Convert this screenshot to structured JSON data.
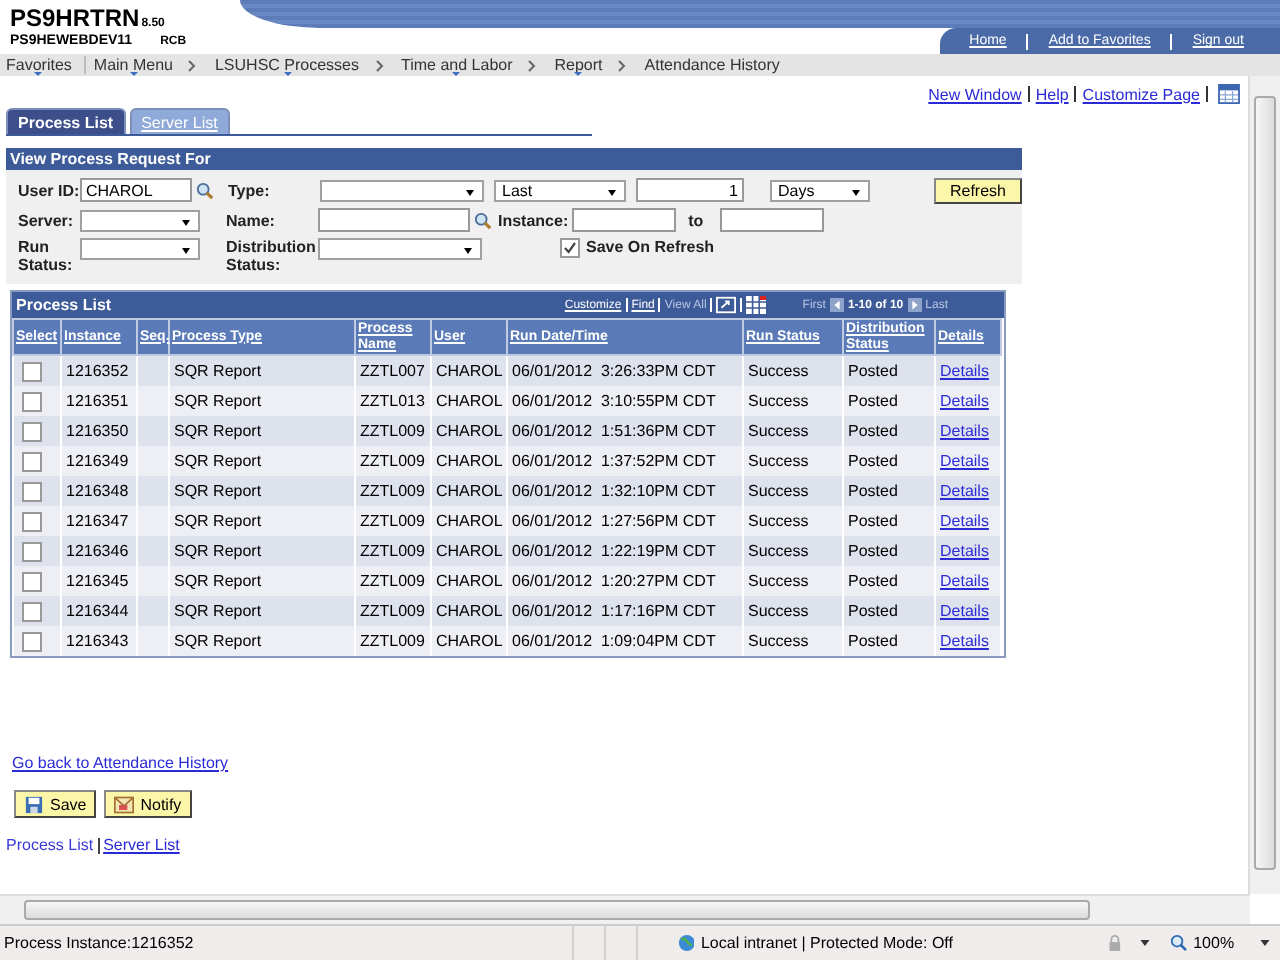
{
  "header": {
    "system": "PS9HRTRN",
    "version": "8.50",
    "server": "PS9HEWEBDEV11",
    "user_code": "RCB",
    "links": [
      "Home",
      "Add to Favorites",
      "Sign out"
    ]
  },
  "nav": [
    {
      "label": "Favorites",
      "menu": true
    },
    {
      "label": "Main Menu",
      "menu": true
    },
    {
      "label": "LSUHSC Processes",
      "menu": true
    },
    {
      "label": "Time and Labor",
      "menu": true
    },
    {
      "label": "Report",
      "menu": true
    },
    {
      "label": "Attendance History",
      "menu": false
    }
  ],
  "page_links": [
    "New Window",
    "Help",
    "Customize Page"
  ],
  "tabs": [
    {
      "label": "Process List",
      "selected": true
    },
    {
      "label": "Server List",
      "selected": false
    }
  ],
  "filter": {
    "title": "View Process Request For",
    "user_id": {
      "label": "User ID:",
      "value": "CHAROL"
    },
    "type": {
      "label": "Type:"
    },
    "range": {
      "mode": "Last",
      "count": "1",
      "period": "Days"
    },
    "refresh": "Refresh",
    "server": {
      "label": "Server:"
    },
    "name": {
      "label": "Name:"
    },
    "instance": {
      "label": "Instance:",
      "to": "to"
    },
    "run_status": {
      "label": "Run Status:"
    },
    "distribution_status": {
      "label": "Distribution Status:"
    },
    "save_on_refresh": {
      "label": "Save On Refresh",
      "checked": true
    }
  },
  "grid": {
    "title": "Process List",
    "tools": [
      "Customize",
      "Find"
    ],
    "view_all": "View All",
    "first": "First",
    "count": "1-10 of 10",
    "last": "Last",
    "columns": [
      "Select",
      "Instance",
      "Seq.",
      "Process Type",
      "Process Name",
      "User",
      "Run Date/Time",
      "Run Status",
      "Distribution Status",
      "Details"
    ],
    "rows": [
      {
        "selected": false,
        "instance": "1216352",
        "process_type": "SQR Report",
        "process_name": "ZZTL007",
        "user": "CHAROL",
        "run_date_time": "06/01/2012  3:26:33PM CDT",
        "run_status": "Success",
        "distribution_status": "Posted",
        "details": "Details"
      },
      {
        "selected": false,
        "instance": "1216351",
        "process_type": "SQR Report",
        "process_name": "ZZTL013",
        "user": "CHAROL",
        "run_date_time": "06/01/2012  3:10:55PM CDT",
        "run_status": "Success",
        "distribution_status": "Posted",
        "details": "Details"
      },
      {
        "selected": false,
        "instance": "1216350",
        "process_type": "SQR Report",
        "process_name": "ZZTL009",
        "user": "CHAROL",
        "run_date_time": "06/01/2012  1:51:36PM CDT",
        "run_status": "Success",
        "distribution_status": "Posted",
        "details": "Details"
      },
      {
        "selected": false,
        "instance": "1216349",
        "process_type": "SQR Report",
        "process_name": "ZZTL009",
        "user": "CHAROL",
        "run_date_time": "06/01/2012  1:37:52PM CDT",
        "run_status": "Success",
        "distribution_status": "Posted",
        "details": "Details"
      },
      {
        "selected": false,
        "instance": "1216348",
        "process_type": "SQR Report",
        "process_name": "ZZTL009",
        "user": "CHAROL",
        "run_date_time": "06/01/2012  1:32:10PM CDT",
        "run_status": "Success",
        "distribution_status": "Posted",
        "details": "Details"
      },
      {
        "selected": false,
        "instance": "1216347",
        "process_type": "SQR Report",
        "process_name": "ZZTL009",
        "user": "CHAROL",
        "run_date_time": "06/01/2012  1:27:56PM CDT",
        "run_status": "Success",
        "distribution_status": "Posted",
        "details": "Details"
      },
      {
        "selected": false,
        "instance": "1216346",
        "process_type": "SQR Report",
        "process_name": "ZZTL009",
        "user": "CHAROL",
        "run_date_time": "06/01/2012  1:22:19PM CDT",
        "run_status": "Success",
        "distribution_status": "Posted",
        "details": "Details"
      },
      {
        "selected": false,
        "instance": "1216345",
        "process_type": "SQR Report",
        "process_name": "ZZTL009",
        "user": "CHAROL",
        "run_date_time": "06/01/2012  1:20:27PM CDT",
        "run_status": "Success",
        "distribution_status": "Posted",
        "details": "Details"
      },
      {
        "selected": false,
        "instance": "1216344",
        "process_type": "SQR Report",
        "process_name": "ZZTL009",
        "user": "CHAROL",
        "run_date_time": "06/01/2012  1:17:16PM CDT",
        "run_status": "Success",
        "distribution_status": "Posted",
        "details": "Details"
      },
      {
        "selected": false,
        "instance": "1216343",
        "process_type": "SQR Report",
        "process_name": "ZZTL009",
        "user": "CHAROL",
        "run_date_time": "06/01/2012  1:09:04PM CDT",
        "run_status": "Success",
        "distribution_status": "Posted",
        "details": "Details"
      }
    ]
  },
  "footer": {
    "back_link": "Go back to Attendance History",
    "buttons": [
      {
        "kind": "save",
        "label": "Save"
      },
      {
        "kind": "notify",
        "label": "Notify"
      }
    ],
    "bottom_links": [
      {
        "label": "Process List",
        "selected": true
      },
      {
        "label": "Server List",
        "selected": false
      }
    ]
  },
  "status_bar": {
    "text": "Process Instance:1216352",
    "zone": "Local intranet | Protected Mode: Off",
    "zoom": "100%"
  }
}
